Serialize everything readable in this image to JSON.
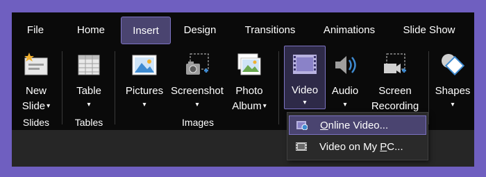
{
  "tabs": [
    {
      "id": "file",
      "label": "File"
    },
    {
      "id": "home",
      "label": "Home"
    },
    {
      "id": "insert",
      "label": "Insert",
      "active": true
    },
    {
      "id": "design",
      "label": "Design"
    },
    {
      "id": "transitions",
      "label": "Transitions"
    },
    {
      "id": "animations",
      "label": "Animations"
    },
    {
      "id": "slideshow",
      "label": "Slide Show"
    }
  ],
  "ribbon": {
    "new_slide": {
      "line1": "New",
      "line2": "Slide",
      "icon": "new-slide-icon"
    },
    "table": {
      "line1": "Table",
      "icon": "table-icon"
    },
    "pictures": {
      "line1": "Pictures",
      "icon": "pictures-icon"
    },
    "screenshot": {
      "line1": "Screenshot",
      "icon": "screenshot-icon"
    },
    "photo_album": {
      "line1": "Photo",
      "line2": "Album",
      "icon": "photo-album-icon"
    },
    "video": {
      "line1": "Video",
      "icon": "video-icon",
      "selected": true
    },
    "audio": {
      "line1": "Audio",
      "icon": "audio-icon"
    },
    "screen_recording": {
      "line1": "Screen",
      "line2": "Recording",
      "icon": "screen-recording-icon"
    },
    "shapes": {
      "line1": "Shapes",
      "icon": "shapes-icon"
    },
    "caret": "▾"
  },
  "groups": {
    "slides": "Slides",
    "tables": "Tables",
    "images": "Images"
  },
  "video_menu": {
    "items": [
      {
        "label_pre": "",
        "label_ul": "O",
        "label_post": "nline Video...",
        "icon": "online-video-icon",
        "highlighted": true
      },
      {
        "label_pre": "Video on My ",
        "label_ul": "P",
        "label_post": "C...",
        "icon": "video-file-icon",
        "highlighted": false
      }
    ]
  },
  "colors": {
    "accent": "#7d74c4",
    "accent_fill": "#4a4470",
    "background": "#0a0a0a",
    "outer": "#6f5fc0"
  }
}
